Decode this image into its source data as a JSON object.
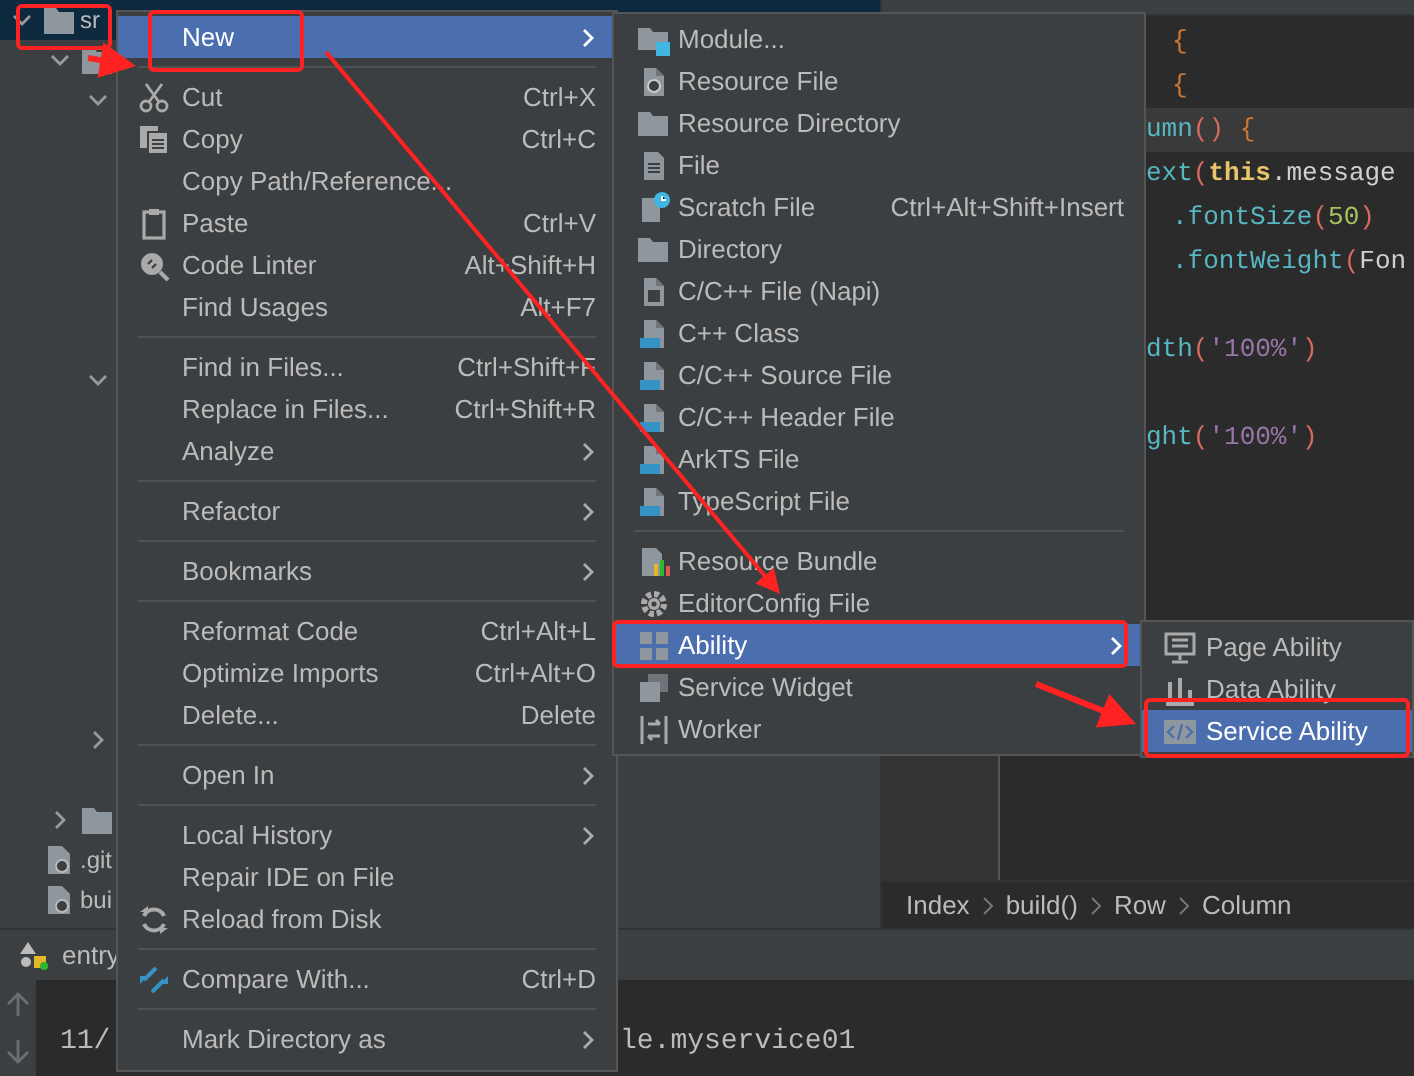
{
  "project_tree": {
    "items": [
      {
        "label": "sr",
        "kind": "folder",
        "expanded": true,
        "selected": true,
        "children": [
          {
            "kind": "folder",
            "expanded": true,
            "selected": false,
            "children": [
              {
                "expanded": true,
                "selected": false
              },
              {
                "expanded": true,
                "selected": false
              },
              {
                "expanded": false,
                "selected": false
              }
            ]
          },
          {
            "kind": "folder",
            "expanded": false,
            "selected": false
          },
          {
            "label": ".git",
            "kind": "file",
            "selected": false
          },
          {
            "label": "bui",
            "kind": "file",
            "selected": false
          }
        ]
      }
    ]
  },
  "editor": {
    "lines": [
      {
        "kind": "indented",
        "highlighted": false,
        "tokens": [
          {
            "text": "{",
            "kind": "brace"
          }
        ]
      },
      {
        "kind": "indented",
        "highlighted": false,
        "tokens": [
          {
            "text": "{",
            "kind": "brace"
          }
        ]
      },
      {
        "kind": "plain",
        "highlighted": true,
        "tokens": [
          {
            "text": "umn",
            "kind": "method"
          },
          {
            "text": "()",
            "kind": "paren"
          },
          {
            "text": " {",
            "kind": "brace"
          }
        ]
      },
      {
        "kind": "plain",
        "highlighted": false,
        "tokens": [
          {
            "text": "ext",
            "kind": "method"
          },
          {
            "text": "(",
            "kind": "paren"
          },
          {
            "text": "this",
            "kind": "keyword"
          },
          {
            "text": ".message",
            "kind": "plain"
          }
        ]
      },
      {
        "kind": "indented",
        "highlighted": false,
        "tokens": [
          {
            "text": ".fontSize",
            "kind": "method"
          },
          {
            "text": "(",
            "kind": "paren"
          },
          {
            "text": "50",
            "kind": "number"
          },
          {
            "text": ")",
            "kind": "paren"
          }
        ]
      },
      {
        "kind": "indented",
        "highlighted": false,
        "tokens": [
          {
            "text": ".fontWeight",
            "kind": "method"
          },
          {
            "text": "(",
            "kind": "paren"
          },
          {
            "text": "Fon",
            "kind": "plain"
          }
        ]
      },
      {
        "kind": "blank"
      },
      {
        "kind": "plain",
        "highlighted": false,
        "tokens": [
          {
            "text": "dth",
            "kind": "method"
          },
          {
            "text": "(",
            "kind": "paren"
          },
          {
            "text": "'100%'",
            "kind": "string"
          },
          {
            "text": ")",
            "kind": "paren"
          }
        ]
      },
      {
        "kind": "blank"
      },
      {
        "kind": "plain",
        "highlighted": false,
        "tokens": [
          {
            "text": "ght",
            "kind": "method"
          },
          {
            "text": "(",
            "kind": "paren"
          },
          {
            "text": "'100%'",
            "kind": "string"
          },
          {
            "text": ")",
            "kind": "paren"
          }
        ]
      }
    ],
    "breadcrumbs": [
      "Index",
      "build()",
      "Row",
      "Column"
    ]
  },
  "tool_window": {
    "tab": "entry",
    "console_lines": [
      "11/",
      "le.myservice01"
    ]
  },
  "context_menu": {
    "items": [
      {
        "kind": "item",
        "label": "New",
        "submenu": true,
        "selected": true
      },
      {
        "kind": "separator"
      },
      {
        "kind": "item",
        "label": "Cut",
        "shortcut": "Ctrl+X",
        "submenu": false,
        "selected": false
      },
      {
        "kind": "item",
        "label": "Copy",
        "shortcut": "Ctrl+C",
        "submenu": false,
        "selected": false
      },
      {
        "kind": "item",
        "label": "Copy Path/Reference...",
        "submenu": false,
        "selected": false
      },
      {
        "kind": "item",
        "label": "Paste",
        "shortcut": "Ctrl+V",
        "submenu": false,
        "selected": false
      },
      {
        "kind": "item",
        "label": "Code Linter",
        "shortcut": "Alt+Shift+H",
        "submenu": false,
        "selected": false
      },
      {
        "kind": "item",
        "label": "Find Usages",
        "shortcut": "Alt+F7",
        "submenu": false,
        "selected": false
      },
      {
        "kind": "separator"
      },
      {
        "kind": "item",
        "label": "Find in Files...",
        "shortcut": "Ctrl+Shift+F",
        "submenu": false,
        "selected": false
      },
      {
        "kind": "item",
        "label": "Replace in Files...",
        "shortcut": "Ctrl+Shift+R",
        "submenu": false,
        "selected": false
      },
      {
        "kind": "item",
        "label": "Analyze",
        "submenu": true,
        "selected": false
      },
      {
        "kind": "separator"
      },
      {
        "kind": "item",
        "label": "Refactor",
        "submenu": true,
        "selected": false
      },
      {
        "kind": "separator"
      },
      {
        "kind": "item",
        "label": "Bookmarks",
        "submenu": true,
        "selected": false
      },
      {
        "kind": "separator"
      },
      {
        "kind": "item",
        "label": "Reformat Code",
        "shortcut": "Ctrl+Alt+L",
        "submenu": false,
        "selected": false
      },
      {
        "kind": "item",
        "label": "Optimize Imports",
        "shortcut": "Ctrl+Alt+O",
        "submenu": false,
        "selected": false
      },
      {
        "kind": "item",
        "label": "Delete...",
        "shortcut": "Delete",
        "submenu": false,
        "selected": false
      },
      {
        "kind": "separator"
      },
      {
        "kind": "item",
        "label": "Open In",
        "submenu": true,
        "selected": false
      },
      {
        "kind": "separator"
      },
      {
        "kind": "item",
        "label": "Local History",
        "submenu": true,
        "selected": false
      },
      {
        "kind": "item",
        "label": "Repair IDE on File",
        "submenu": false,
        "selected": false
      },
      {
        "kind": "item",
        "label": "Reload from Disk",
        "submenu": false,
        "selected": false
      },
      {
        "kind": "separator"
      },
      {
        "kind": "item",
        "label": "Compare With...",
        "shortcut": "Ctrl+D",
        "submenu": false,
        "selected": false
      },
      {
        "kind": "separator"
      },
      {
        "kind": "item",
        "label": "Mark Directory as",
        "submenu": true,
        "selected": false
      }
    ]
  },
  "new_submenu": {
    "items": [
      {
        "kind": "item",
        "label": "Module...",
        "submenu": false,
        "selected": false
      },
      {
        "kind": "item",
        "label": "Resource File",
        "submenu": false,
        "selected": false
      },
      {
        "kind": "item",
        "label": "Resource Directory",
        "submenu": false,
        "selected": false
      },
      {
        "kind": "item",
        "label": "File",
        "submenu": false,
        "selected": false
      },
      {
        "kind": "item",
        "label": "Scratch File",
        "shortcut": "Ctrl+Alt+Shift+Insert",
        "submenu": false,
        "selected": false
      },
      {
        "kind": "item",
        "label": "Directory",
        "submenu": false,
        "selected": false
      },
      {
        "kind": "item",
        "label": "C/C++ File (Napi)",
        "submenu": false,
        "selected": false
      },
      {
        "kind": "item",
        "label": "C++ Class",
        "submenu": false,
        "selected": false
      },
      {
        "kind": "item",
        "label": "C/C++ Source File",
        "submenu": false,
        "selected": false
      },
      {
        "kind": "item",
        "label": "C/C++ Header File",
        "submenu": false,
        "selected": false
      },
      {
        "kind": "item",
        "label": "ArkTS File",
        "submenu": false,
        "selected": false
      },
      {
        "kind": "item",
        "label": "TypeScript File",
        "submenu": false,
        "selected": false
      },
      {
        "kind": "separator"
      },
      {
        "kind": "item",
        "label": "Resource Bundle",
        "submenu": false,
        "selected": false
      },
      {
        "kind": "item",
        "label": "EditorConfig File",
        "submenu": false,
        "selected": false
      },
      {
        "kind": "item",
        "label": "Ability",
        "submenu": true,
        "selected": true
      },
      {
        "kind": "item",
        "label": "Service Widget",
        "submenu": false,
        "selected": false
      },
      {
        "kind": "item",
        "label": "Worker",
        "submenu": false,
        "selected": false
      }
    ]
  },
  "ability_submenu": {
    "items": [
      {
        "kind": "item",
        "label": "Page Ability",
        "submenu": false,
        "selected": false
      },
      {
        "kind": "item",
        "label": "Data Ability",
        "submenu": false,
        "selected": false
      },
      {
        "kind": "item",
        "label": "Service Ability",
        "submenu": false,
        "selected": true
      }
    ]
  }
}
